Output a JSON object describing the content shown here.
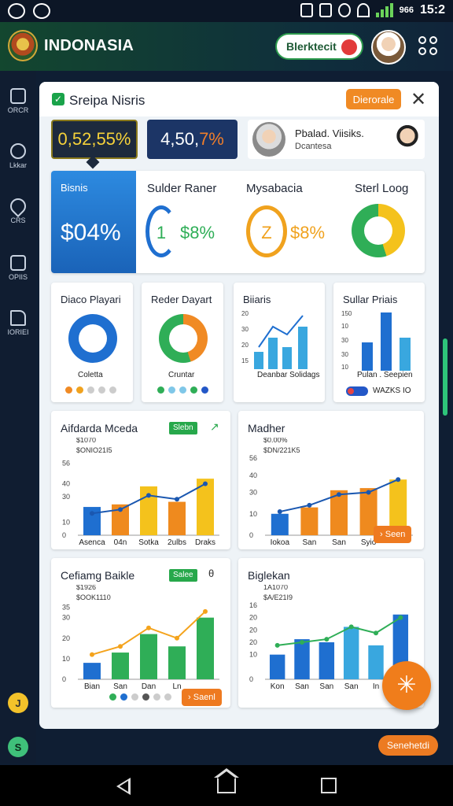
{
  "status_bar": {
    "time": "15:2",
    "signal_label": "966",
    "battery": "▮"
  },
  "app_bar": {
    "title": "INDONASIA",
    "cta_label": "Blerktecit"
  },
  "side_nav": {
    "items": [
      {
        "label": "ORCR",
        "icon": "document-icon"
      },
      {
        "label": "Lkkar",
        "icon": "search-icon"
      },
      {
        "label": "CRS",
        "icon": "pen-icon"
      },
      {
        "label": "OPIIS",
        "icon": "grid-icon"
      },
      {
        "label": "IORIEI",
        "icon": "folder-icon"
      }
    ],
    "bubble_top": "J",
    "bubble_bottom": "S"
  },
  "panel": {
    "title": "Sreipa Nisris",
    "header_button": "Dierorale",
    "close": "✕",
    "kpi_yellow": "0,52,55%",
    "kpi_blue_value": "4,50,",
    "kpi_blue_pct": "7%",
    "person": {
      "name": "Pbalad. Viisiks.",
      "role": "Dcantesa"
    }
  },
  "metric_strip": {
    "blue": {
      "label": "Bisnis",
      "value": "$04%"
    },
    "col1": {
      "label": "Sulder Raner",
      "ring_text": "1",
      "value": "$8%"
    },
    "col2": {
      "label": "Mysabacia",
      "ring_text": "Z",
      "value": "$8%"
    },
    "col3": {
      "label": "Sterl Loog"
    }
  },
  "small_cards": {
    "c1": {
      "title": "Diaco Playari",
      "caption": "Coletta"
    },
    "c2": {
      "title": "Reder Dayart",
      "caption": "Cruntar"
    },
    "c3": {
      "title": "Biiaris",
      "caption": "Deanbar Solidags",
      "y_ticks": [
        "20",
        "30",
        "20",
        "15"
      ]
    },
    "c4": {
      "title": "Sullar Priais",
      "caption": "Pulan . Seepien",
      "y_ticks": [
        "150",
        "10",
        "30",
        "30",
        "10"
      ],
      "toggle_label": "WAZKS IO"
    }
  },
  "chart_data": [
    {
      "type": "bar",
      "title": "Aifdarda Mceda",
      "tag": "Slebn",
      "sub_lines": [
        "$1070",
        "$ONIO21I5"
      ],
      "categories": [
        "Asenca",
        "04n",
        "Sotka",
        "2ulbs",
        "Draks"
      ],
      "values": [
        22,
        24,
        38,
        26,
        44
      ],
      "line": [
        17,
        20,
        31,
        28,
        40
      ],
      "y_ticks": [
        "56",
        "40",
        "30",
        "10",
        "0"
      ],
      "y_values": [
        56,
        40,
        30,
        10,
        0
      ],
      "ylim": [
        0,
        60
      ],
      "colors": [
        "#1f6fd0",
        "#ef8a1e",
        "#f4c21c",
        "#ef8a1e",
        "#f4c21c"
      ]
    },
    {
      "type": "bar",
      "title": "Madher",
      "sub_lines": [
        "$0.00%",
        "$DN/221K5"
      ],
      "categories": [
        "Iokoa",
        "San",
        "San",
        "Syio"
      ],
      "values": [
        10,
        13,
        21,
        22,
        26
      ],
      "line": [
        11,
        14,
        19,
        20,
        26
      ],
      "y_ticks": [
        "56",
        "40",
        "30",
        "10",
        "0"
      ],
      "y_values": [
        36,
        28,
        20,
        10,
        0
      ],
      "ylim": [
        0,
        36
      ],
      "colors": [
        "#1f6fd0",
        "#ef8a1e",
        "#ef8a1e",
        "#ef8a1e",
        "#f4c21c"
      ],
      "button": "Seen"
    },
    {
      "type": "bar",
      "title": "Cefiamg Baikle",
      "tag": "Salee",
      "sub_lines": [
        "$1926",
        "$OOK1110"
      ],
      "categories": [
        "Bian",
        "San",
        "Dan",
        "Ln"
      ],
      "values": [
        8,
        13,
        22,
        16,
        30
      ],
      "line": [
        12,
        16,
        25,
        20,
        33
      ],
      "y_ticks": [
        "35",
        "30",
        "20",
        "10",
        "0"
      ],
      "y_values": [
        35,
        30,
        20,
        10,
        0
      ],
      "ylim": [
        0,
        36
      ],
      "colors": [
        "#1f6fd0",
        "#2fae57",
        "#2fae57",
        "#2fae57",
        "#2fae57"
      ],
      "button": "Saenl"
    },
    {
      "type": "bar",
      "title": "Biglekan",
      "sub_lines": [
        "1A1070",
        "$A/E21I9"
      ],
      "categories": [
        "Kon",
        "San",
        "San",
        "San",
        "In"
      ],
      "values": [
        8,
        13,
        12,
        17,
        11,
        21
      ],
      "line": [
        11,
        12,
        13,
        17,
        15,
        20
      ],
      "y_ticks": [
        "16",
        "20",
        "20",
        "20",
        "10",
        "0"
      ],
      "y_values": [
        24,
        20,
        16,
        12,
        8,
        0
      ],
      "ylim": [
        0,
        24
      ],
      "colors": [
        "#1f6fd0",
        "#1f6fd0",
        "#1f6fd0",
        "#39a7df",
        "#39a7df",
        "#1f6fd0"
      ]
    }
  ],
  "footer": {
    "button": "Senehetdi"
  },
  "colors": {
    "brand": "#13472f",
    "accent_orange": "#f08a24",
    "accent_blue": "#1f6fd0",
    "accent_green": "#27a84b",
    "accent_yellow": "#f4c21c"
  }
}
